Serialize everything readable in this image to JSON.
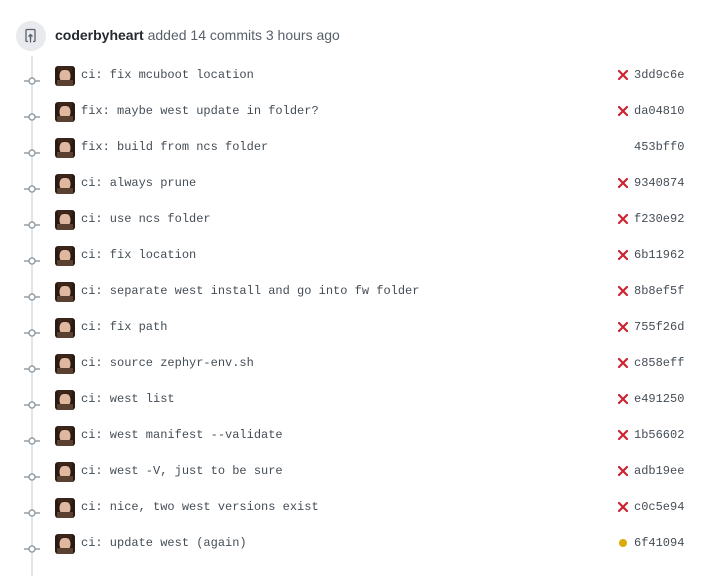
{
  "header": {
    "author": "coderbyheart",
    "action_text": " added 14 commits 3 hours ago"
  },
  "commits": [
    {
      "message": "ci: fix mcuboot location",
      "sha": "3dd9c6e",
      "status": "failure"
    },
    {
      "message": "fix: maybe west update in folder?",
      "sha": "da04810",
      "status": "failure"
    },
    {
      "message": "fix: build from ncs folder",
      "sha": "453bff0",
      "status": "none"
    },
    {
      "message": "ci: always prune",
      "sha": "9340874",
      "status": "failure"
    },
    {
      "message": "ci: use ncs folder",
      "sha": "f230e92",
      "status": "failure"
    },
    {
      "message": "ci: fix location",
      "sha": "6b11962",
      "status": "failure"
    },
    {
      "message": "ci: separate west install and go into fw folder",
      "sha": "8b8ef5f",
      "status": "failure"
    },
    {
      "message": "ci: fix path",
      "sha": "755f26d",
      "status": "failure"
    },
    {
      "message": "ci: source zephyr-env.sh",
      "sha": "c858eff",
      "status": "failure"
    },
    {
      "message": "ci: west list",
      "sha": "e491250",
      "status": "failure"
    },
    {
      "message": "ci: west manifest --validate",
      "sha": "1b56602",
      "status": "failure"
    },
    {
      "message": "ci: west -V, just to be sure",
      "sha": "adb19ee",
      "status": "failure"
    },
    {
      "message": "ci: nice, two west versions exist",
      "sha": "c0c5e94",
      "status": "failure"
    },
    {
      "message": "ci: update west (again)",
      "sha": "6f41094",
      "status": "pending"
    }
  ],
  "colors": {
    "failure": "#cb2431",
    "pending": "#dbab09",
    "timeline": "#e1e4e8",
    "node": "#959da5"
  },
  "icons": {
    "header": "repo-push-icon",
    "commit_node": "git-commit-icon",
    "failure": "x-icon",
    "pending": "dot-fill-icon"
  }
}
